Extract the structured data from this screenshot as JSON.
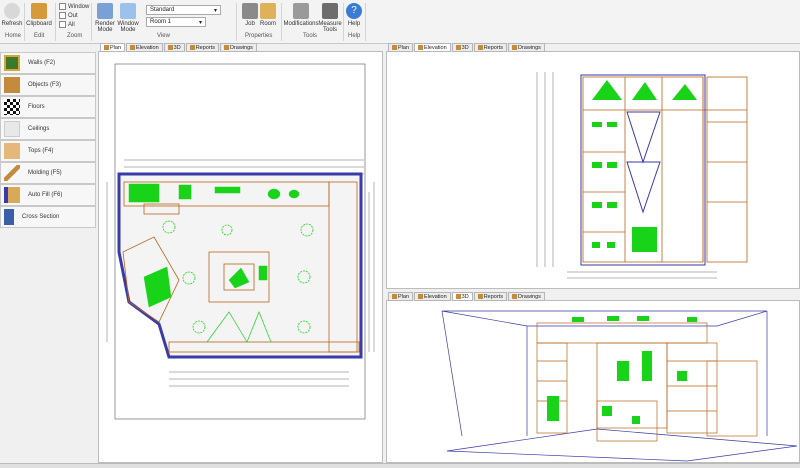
{
  "ribbon": {
    "home": {
      "label": "Refresh",
      "group": "Home"
    },
    "edit": {
      "label": "Clipboard",
      "group": "Edit"
    },
    "zoom": {
      "items": [
        "Window",
        "Out",
        "All"
      ],
      "group": "Zoom"
    },
    "view": {
      "render_mode": "Render Mode",
      "window_mode": "Window Mode",
      "style": "Standard",
      "room": "Room 1",
      "group": "View"
    },
    "properties": {
      "job": "Job",
      "room": "Room",
      "group": "Properties"
    },
    "tools": {
      "modifications": "Modifications",
      "measure": "Measure Tools",
      "group": "Tools"
    },
    "help": {
      "label": "Help",
      "group": "Help"
    }
  },
  "sidebar": {
    "items": [
      {
        "label": "Walls (F2)",
        "icon": "walls-icon"
      },
      {
        "label": "Objects (F3)",
        "icon": "objects-icon"
      },
      {
        "label": "Floors",
        "icon": "floors-icon"
      },
      {
        "label": "Ceilings",
        "icon": "ceilings-icon"
      },
      {
        "label": "Tops (F4)",
        "icon": "tops-icon"
      },
      {
        "label": "Molding (F5)",
        "icon": "molding-icon"
      },
      {
        "label": "Auto Fill (F6)",
        "icon": "auto-fill-icon"
      },
      {
        "label": "Cross Section",
        "icon": "cross-section-icon"
      }
    ]
  },
  "panes": {
    "plan": {
      "tabs": [
        "Plan",
        "Elevation",
        "3D",
        "Reports",
        "Drawings"
      ],
      "active": "Plan"
    },
    "elevation": {
      "tabs": [
        "Plan",
        "Elevation",
        "3D",
        "Reports",
        "Drawings"
      ],
      "active": "Elevation"
    },
    "three_d": {
      "tabs": [
        "Plan",
        "Elevation",
        "3D",
        "Reports",
        "Drawings"
      ],
      "active": "3D"
    }
  },
  "colors": {
    "wall": "#3a3aa8",
    "cabinet": "#b8651c",
    "accessory": "#19d319",
    "dimension": "#333333"
  }
}
